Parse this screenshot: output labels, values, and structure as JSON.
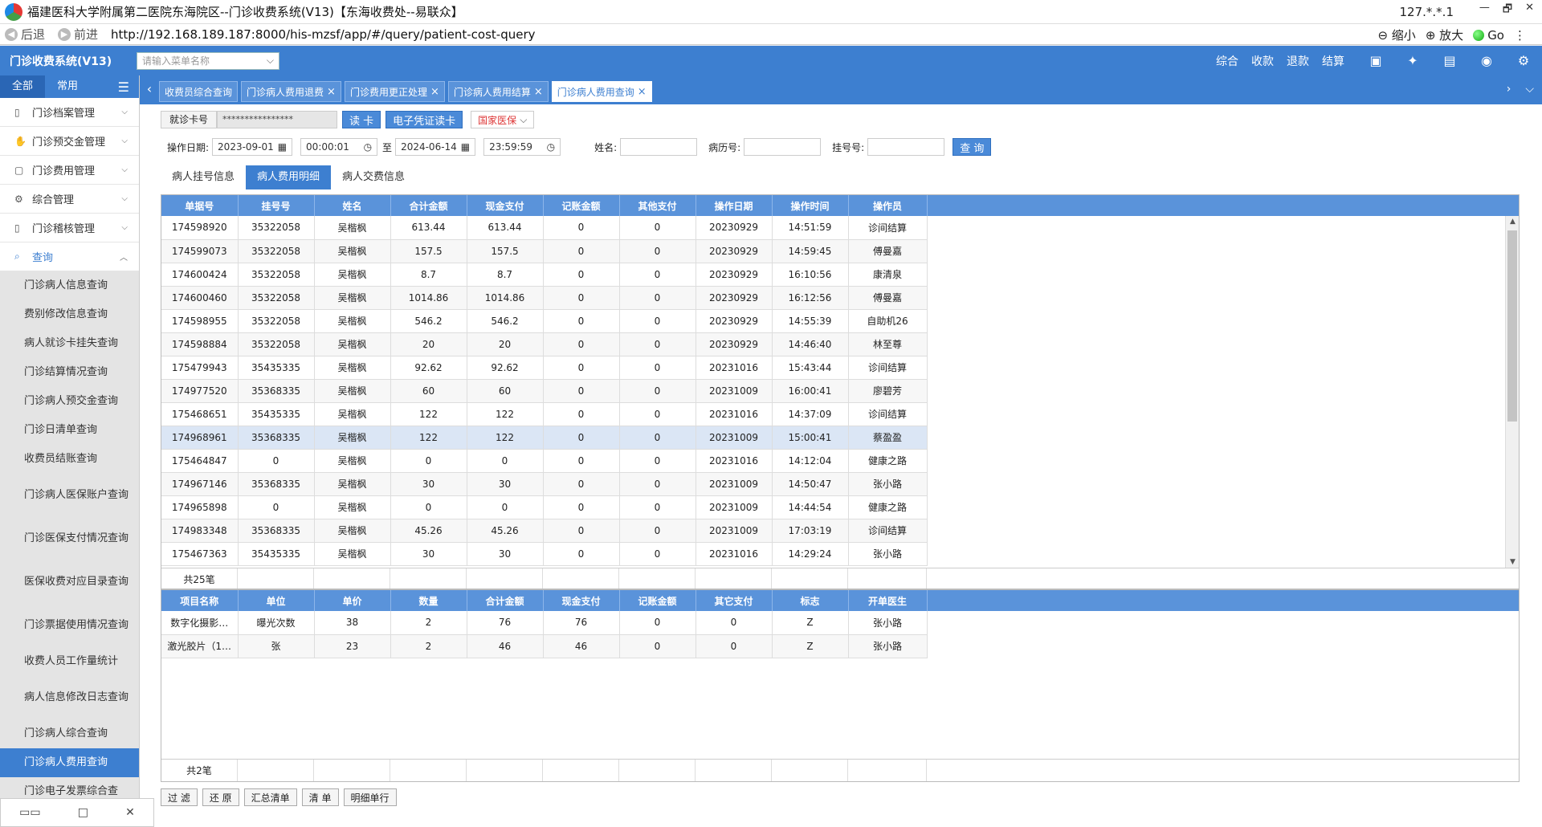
{
  "window": {
    "title": "福建医科大学附属第二医院东海院区--门诊收费系统(V13)【东海收费处--易联众】",
    "ip": "127.*.*.1",
    "controls": [
      "—",
      "🗗",
      "✕"
    ]
  },
  "addressbar": {
    "back": "后退",
    "forward": "前进",
    "url": "http://192.168.189.187:8000/his-mzsf/app/#/query/patient-cost-query",
    "zoom_out": "缩小",
    "zoom_in": "放大",
    "go": "Go"
  },
  "app": {
    "name": "门诊收费系统(V13)",
    "menu_search_placeholder": "请输入菜单名称",
    "top_nav": [
      "综合",
      "收款",
      "退款",
      "结算"
    ]
  },
  "sidebar": {
    "tab_all": "全部",
    "tab_common": "常用",
    "sections": [
      {
        "label": "门诊档案管理"
      },
      {
        "label": "门诊预交金管理"
      },
      {
        "label": "门诊费用管理"
      },
      {
        "label": "综合管理"
      },
      {
        "label": "门诊稽核管理"
      },
      {
        "label": "查询"
      }
    ],
    "items": [
      "门诊病人信息查询",
      "费别修改信息查询",
      "病人就诊卡挂失查询",
      "门诊结算情况查询",
      "门诊病人预交金查询",
      "门诊日清单查询",
      "收费员结账查询",
      "门诊病人医保账户查询",
      "门诊医保支付情况查询",
      "医保收费对应目录查询",
      "门诊票据使用情况查询",
      "收费人员工作量统计",
      "病人信息修改日志查询",
      "门诊病人综合查询",
      "门诊病人费用查询",
      "门诊电子发票综合查"
    ]
  },
  "tabs": [
    {
      "label": "收费员综合查询",
      "closable": false
    },
    {
      "label": "门诊病人费用退费",
      "closable": true
    },
    {
      "label": "门诊费用更正处理",
      "closable": true
    },
    {
      "label": "门诊病人费用结算",
      "closable": true
    },
    {
      "label": "门诊病人费用查询",
      "closable": true
    }
  ],
  "form": {
    "card_label": "就诊卡号",
    "card_value": "****************",
    "read_card": "读 卡",
    "e_voucher": "电子凭证读卡",
    "national_insurance": "国家医保",
    "op_date_label": "操作日期:",
    "date_from": "2023-09-01",
    "time_from": "00:00:01",
    "to": "至",
    "date_to": "2024-06-14",
    "time_to": "23:59:59",
    "name_label": "姓名:",
    "record_label": "病历号:",
    "reg_label": "挂号号:",
    "query": "查 询"
  },
  "subtabs": [
    "病人挂号信息",
    "病人费用明细",
    "病人交费信息"
  ],
  "main_table": {
    "headers": [
      "单据号",
      "挂号号",
      "姓名",
      "合计金额",
      "现金支付",
      "记账金额",
      "其他支付",
      "操作日期",
      "操作时间",
      "操作员"
    ],
    "rows": [
      [
        "174598920",
        "35322058",
        "吴楷枫",
        "613.44",
        "613.44",
        "0",
        "0",
        "20230929",
        "14:51:59",
        "诊间结算"
      ],
      [
        "174599073",
        "35322058",
        "吴楷枫",
        "157.5",
        "157.5",
        "0",
        "0",
        "20230929",
        "14:59:45",
        "傅曼嘉"
      ],
      [
        "174600424",
        "35322058",
        "吴楷枫",
        "8.7",
        "8.7",
        "0",
        "0",
        "20230929",
        "16:10:56",
        "康清泉"
      ],
      [
        "174600460",
        "35322058",
        "吴楷枫",
        "1014.86",
        "1014.86",
        "0",
        "0",
        "20230929",
        "16:12:56",
        "傅曼嘉"
      ],
      [
        "174598955",
        "35322058",
        "吴楷枫",
        "546.2",
        "546.2",
        "0",
        "0",
        "20230929",
        "14:55:39",
        "自助机26"
      ],
      [
        "174598884",
        "35322058",
        "吴楷枫",
        "20",
        "20",
        "0",
        "0",
        "20230929",
        "14:46:40",
        "林至尊"
      ],
      [
        "175479943",
        "35435335",
        "吴楷枫",
        "92.62",
        "92.62",
        "0",
        "0",
        "20231016",
        "15:43:44",
        "诊间结算"
      ],
      [
        "174977520",
        "35368335",
        "吴楷枫",
        "60",
        "60",
        "0",
        "0",
        "20231009",
        "16:00:41",
        "廖碧芳"
      ],
      [
        "175468651",
        "35435335",
        "吴楷枫",
        "122",
        "122",
        "0",
        "0",
        "20231016",
        "14:37:09",
        "诊间结算"
      ],
      [
        "174968961",
        "35368335",
        "吴楷枫",
        "122",
        "122",
        "0",
        "0",
        "20231009",
        "15:00:41",
        "蔡盈盈"
      ],
      [
        "175464847",
        "0",
        "吴楷枫",
        "0",
        "0",
        "0",
        "0",
        "20231016",
        "14:12:04",
        "健康之路"
      ],
      [
        "174967146",
        "35368335",
        "吴楷枫",
        "30",
        "30",
        "0",
        "0",
        "20231009",
        "14:50:47",
        "张小路"
      ],
      [
        "174965898",
        "0",
        "吴楷枫",
        "0",
        "0",
        "0",
        "0",
        "20231009",
        "14:44:54",
        "健康之路"
      ],
      [
        "174983348",
        "35368335",
        "吴楷枫",
        "45.26",
        "45.26",
        "0",
        "0",
        "20231009",
        "17:03:19",
        "诊间结算"
      ],
      [
        "175467363",
        "35435335",
        "吴楷枫",
        "30",
        "30",
        "0",
        "0",
        "20231016",
        "14:29:24",
        "张小路"
      ]
    ],
    "total": "共25笔"
  },
  "detail_table": {
    "headers": [
      "项目名称",
      "单位",
      "单价",
      "数量",
      "合计金额",
      "现金支付",
      "记账金额",
      "其它支付",
      "标志",
      "开单医生"
    ],
    "rows": [
      [
        "数字化摄影…",
        "曝光次数",
        "38",
        "2",
        "76",
        "76",
        "0",
        "0",
        "Z",
        "张小路"
      ],
      [
        "激光胶片（1…",
        "张",
        "23",
        "2",
        "46",
        "46",
        "0",
        "0",
        "Z",
        "张小路"
      ]
    ],
    "total": "共2笔"
  },
  "bottom_buttons": [
    "过 滤",
    "还 原",
    "汇总清单",
    "清 单",
    "明细单行"
  ],
  "accent_color": "#3d7fd0"
}
